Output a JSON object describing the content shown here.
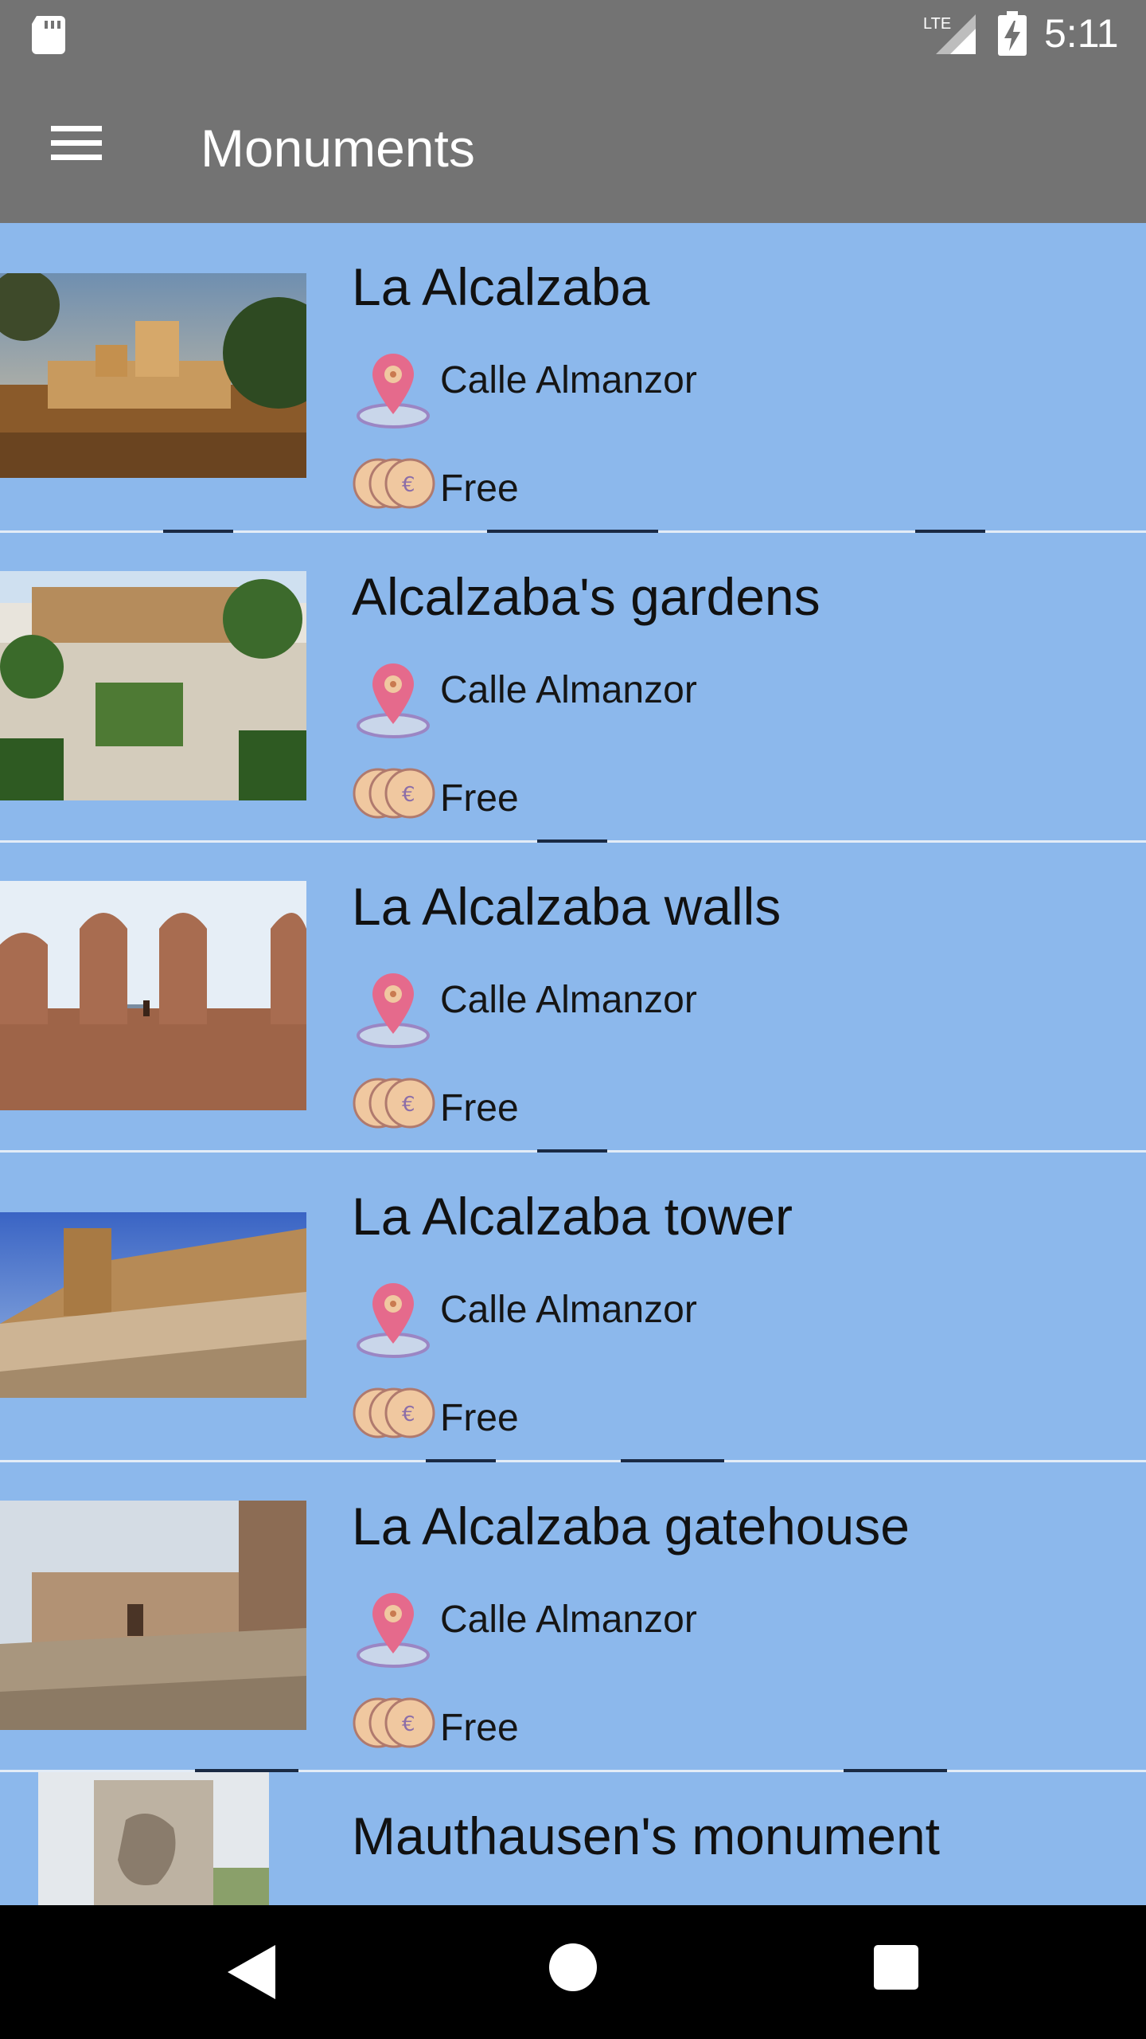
{
  "status_bar": {
    "time": "5:11",
    "network": "LTE",
    "icons": [
      "sd-card-icon",
      "lte-signal-icon",
      "battery-charging-icon"
    ]
  },
  "app_bar": {
    "title": "Monuments",
    "menu_icon": "hamburger-menu-icon"
  },
  "monuments": [
    {
      "name": "La Alcalzaba",
      "address": "Calle Almanzor",
      "price": "Free",
      "image": "castle-landscape"
    },
    {
      "name": "Alcalzaba's gardens",
      "address": "Calle Almanzor",
      "price": "Free",
      "image": "gardens"
    },
    {
      "name": "La Alcalzaba walls",
      "address": "Calle Almanzor",
      "price": "Free",
      "image": "walls"
    },
    {
      "name": "La Alcalzaba tower",
      "address": "Calle Almanzor",
      "price": "Free",
      "image": "tower"
    },
    {
      "name": "La Alcalzaba gatehouse",
      "address": "Calle Almanzor",
      "price": "Free",
      "image": "gatehouse"
    },
    {
      "name": "Mauthausen's monument",
      "image": "statue"
    }
  ],
  "icons": {
    "location": "location-pin-icon",
    "price": "euro-coins-icon"
  },
  "colors": {
    "bar": "#737373",
    "list_background": "#8cb8ec",
    "pin": "#e56a8c",
    "coin": "#f0c8a0"
  },
  "nav_bar": {
    "buttons": [
      "back-button",
      "home-button",
      "recents-button"
    ]
  }
}
